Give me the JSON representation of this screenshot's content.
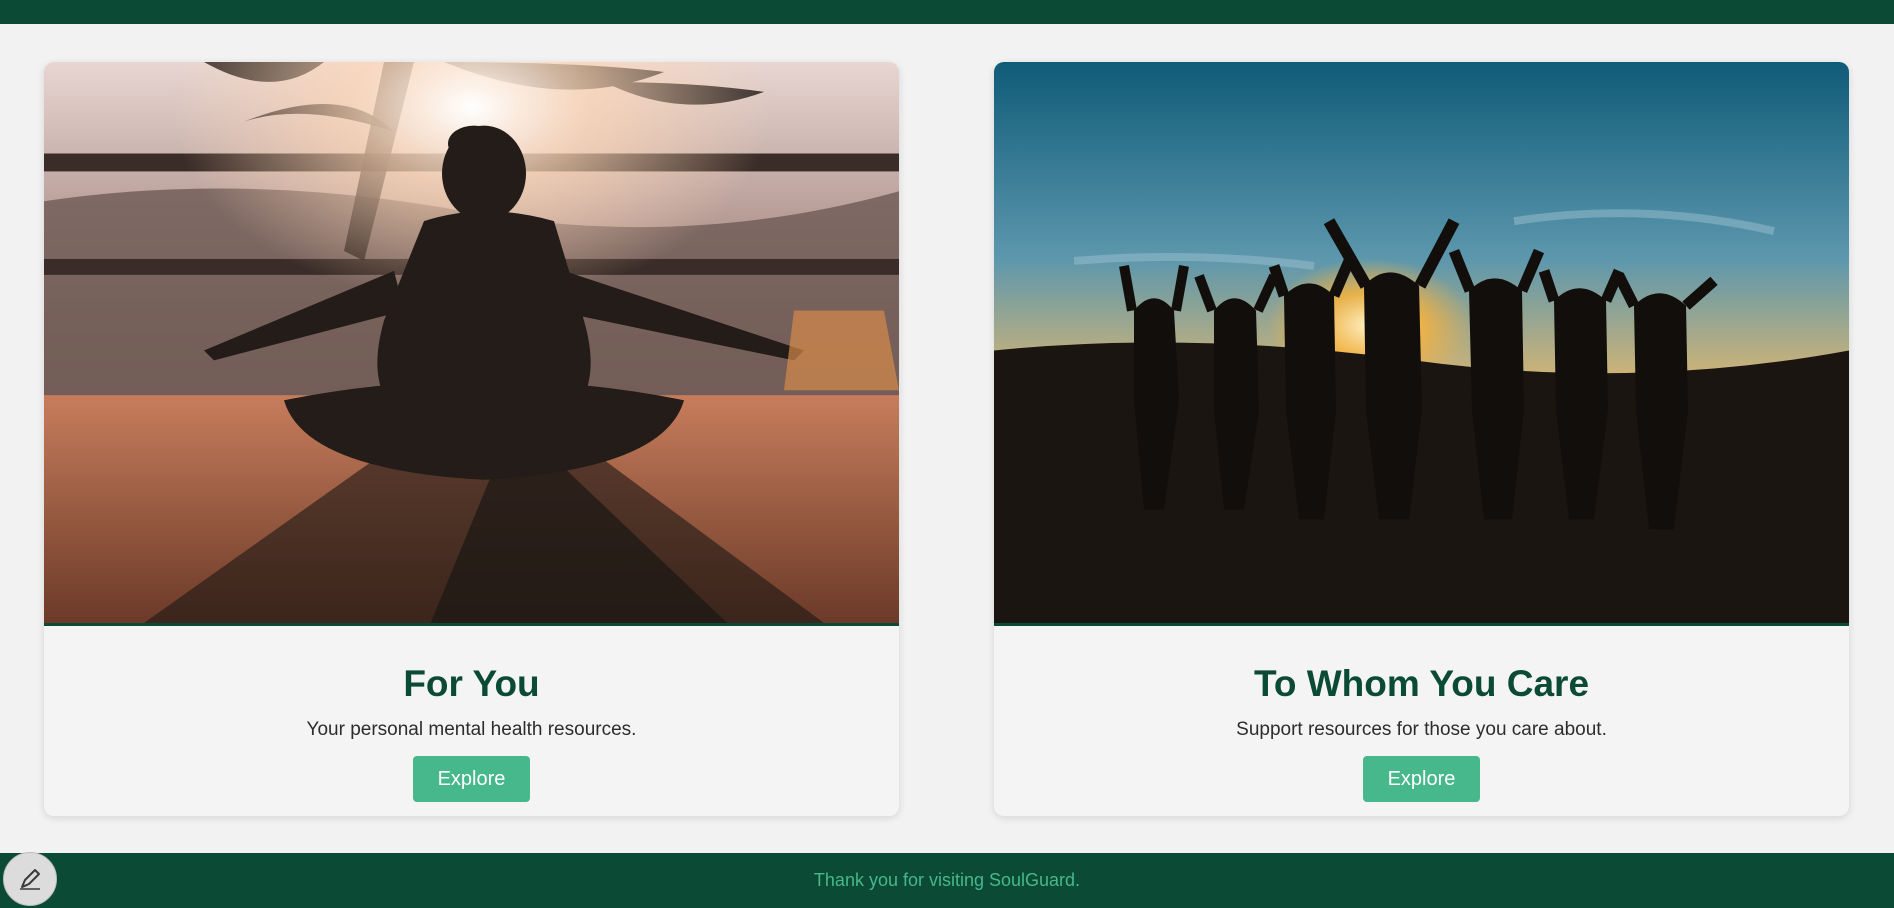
{
  "colors": {
    "brand_dark": "#0b4a35",
    "accent": "#46b88b",
    "background": "#f2f2f2"
  },
  "cards": [
    {
      "title": "For You",
      "description": "Your personal mental health resources.",
      "button_label": "Explore"
    },
    {
      "title": "To Whom You Care",
      "description": "Support resources for those you care about.",
      "button_label": "Explore"
    }
  ],
  "footer": {
    "text": "Thank you for visiting SoulGuard."
  },
  "fab": {
    "icon": "pen-icon"
  }
}
